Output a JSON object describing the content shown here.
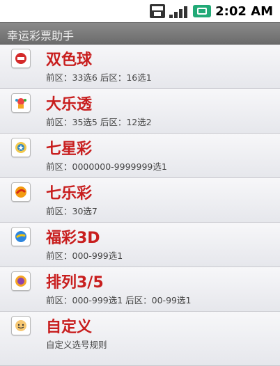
{
  "status": {
    "time": "2:02 AM",
    "network": "3G",
    "icons": [
      "3g-icon",
      "signal-icon",
      "battery-icon"
    ]
  },
  "app": {
    "title": "幸运彩票助手"
  },
  "items": [
    {
      "title": "双色球",
      "desc": "前区：33选6  后区：16选1",
      "icon": "red-ball-icon"
    },
    {
      "title": "大乐透",
      "desc": "前区：35选5  后区：12选2",
      "icon": "lottery-figure-icon"
    },
    {
      "title": "七星彩",
      "desc": "前区：0000000-9999999选1",
      "icon": "star-badge-icon"
    },
    {
      "title": "七乐彩",
      "desc": "前区：30选7",
      "icon": "orange-ball-icon"
    },
    {
      "title": "福彩3D",
      "desc": "前区：000-999选1",
      "icon": "blue-orb-icon"
    },
    {
      "title": "排列3/5",
      "desc": "前区：000-999选1  后区：00-99选1",
      "icon": "purple-ball-icon"
    },
    {
      "title": "自定义",
      "desc": "自定义选号规则",
      "icon": "custom-face-icon"
    }
  ],
  "colors": {
    "title": "#c81e1e",
    "titlebar": "#7a7a7a"
  }
}
